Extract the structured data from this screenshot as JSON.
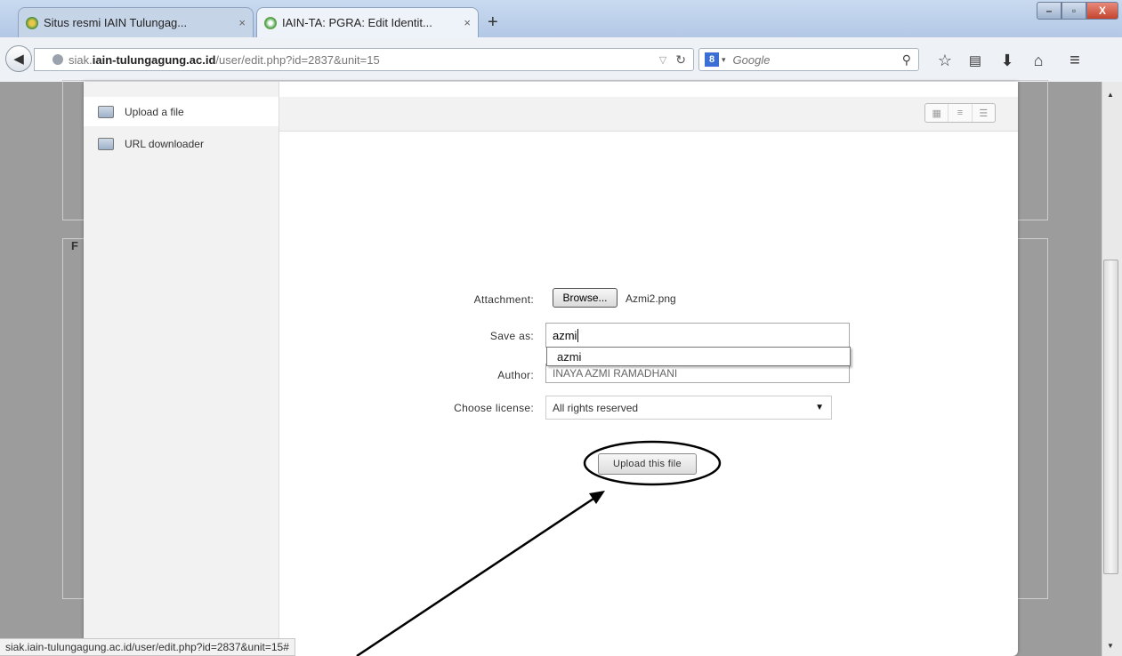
{
  "tabs": [
    {
      "title": "Situs resmi IAIN Tulungag...",
      "close": "×"
    },
    {
      "title": "IAIN-TA: PGRA: Edit Identit...",
      "close": "×"
    }
  ],
  "new_tab": "+",
  "window_controls": {
    "minimize": "–",
    "maximize": "▫",
    "close": "X"
  },
  "url": {
    "subdomain": "siak.",
    "domain": "iain-tulungagung.ac.id",
    "path": "/user/edit.php?id=2837&unit=15"
  },
  "search": {
    "engine": "8",
    "placeholder": "Google"
  },
  "page": {
    "fieldset_fragment": "F"
  },
  "file_picker": {
    "repositories": [
      {
        "label": "Upload a file",
        "icon": "upload-repo-icon"
      },
      {
        "label": "URL downloader",
        "icon": "url-repo-icon"
      }
    ],
    "form": {
      "attachment_label": "Attachment:",
      "browse_label": "Browse...",
      "selected_file": "Azmi2.png",
      "saveas_label": "Save as:",
      "saveas_value": "azmi",
      "autocomplete_suggestion": "azmi",
      "author_label": "Author:",
      "author_value": "INAYA AZMI RAMADHANI",
      "license_label": "Choose license:",
      "license_value": "All rights reserved",
      "upload_button": "Upload this file"
    }
  },
  "status_bar": "siak.iain-tulungagung.ac.id/user/edit.php?id=2837&unit=15#"
}
